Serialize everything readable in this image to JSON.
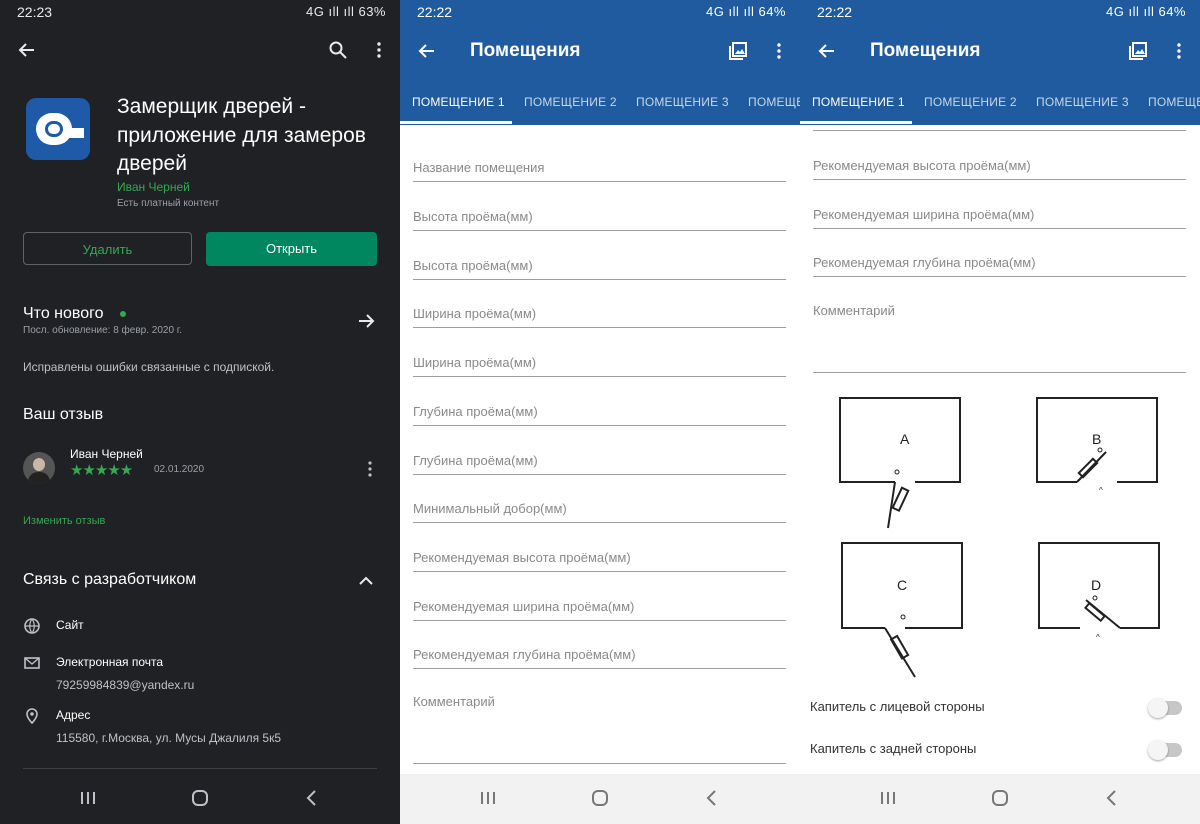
{
  "play": {
    "status": {
      "time": "22:23",
      "signal": "4G ıll ıll 63%"
    },
    "app_title": "Замерщик дверей - приложение для замеров дверей",
    "developer": "Иван Черней",
    "paid_note": "Есть платный контент",
    "uninstall_label": "Удалить",
    "open_label": "Открыть",
    "whats_new": {
      "heading": "Что нового",
      "updated": "Посл. обновление: 8 февр. 2020 г.",
      "text": "Исправлены ошибки связанные с подпиской."
    },
    "review": {
      "heading": "Ваш отзыв",
      "author": "Иван Черней",
      "stars": "★★★★★",
      "date": "02.01.2020",
      "edit_label": "Изменить отзыв"
    },
    "contact": {
      "heading": "Связь с разработчиком",
      "site_label": "Сайт",
      "email_label": "Электронная почта",
      "email_value": "79259984839@yandex.ru",
      "address_label": "Адрес",
      "address_value": "115580, г.Москва, ул. Мусы Джалиля 5к5"
    }
  },
  "rooms": {
    "status_time": "22:22",
    "status_signal": "4G ıll ıll 64%",
    "title": "Помещения",
    "tabs": [
      "ПОМЕЩЕНИЕ 1",
      "ПОМЕЩЕНИЕ 2",
      "ПОМЕЩЕНИЕ 3",
      "ПОМЕЩЕ"
    ],
    "fields": [
      "Название помещения",
      "Высота проёма(мм)",
      "Высота проёма(мм)",
      "Ширина проёма(мм)",
      "Ширина проёма(мм)",
      "Глубина проёма(мм)",
      "Глубина проёма(мм)",
      "Минимальный добор(мм)",
      "Рекомендуемая высота проёма(мм)",
      "Рекомендуемая ширина проёма(мм)",
      "Рекомендуемая глубина проёма(мм)",
      "Комментарий"
    ],
    "diagram_labels": [
      "A",
      "B",
      "C",
      "D"
    ],
    "toggles": [
      {
        "label": "Капитель с лицевой стороны",
        "on": false
      },
      {
        "label": "Капитель с задней стороны",
        "on": false
      }
    ]
  }
}
